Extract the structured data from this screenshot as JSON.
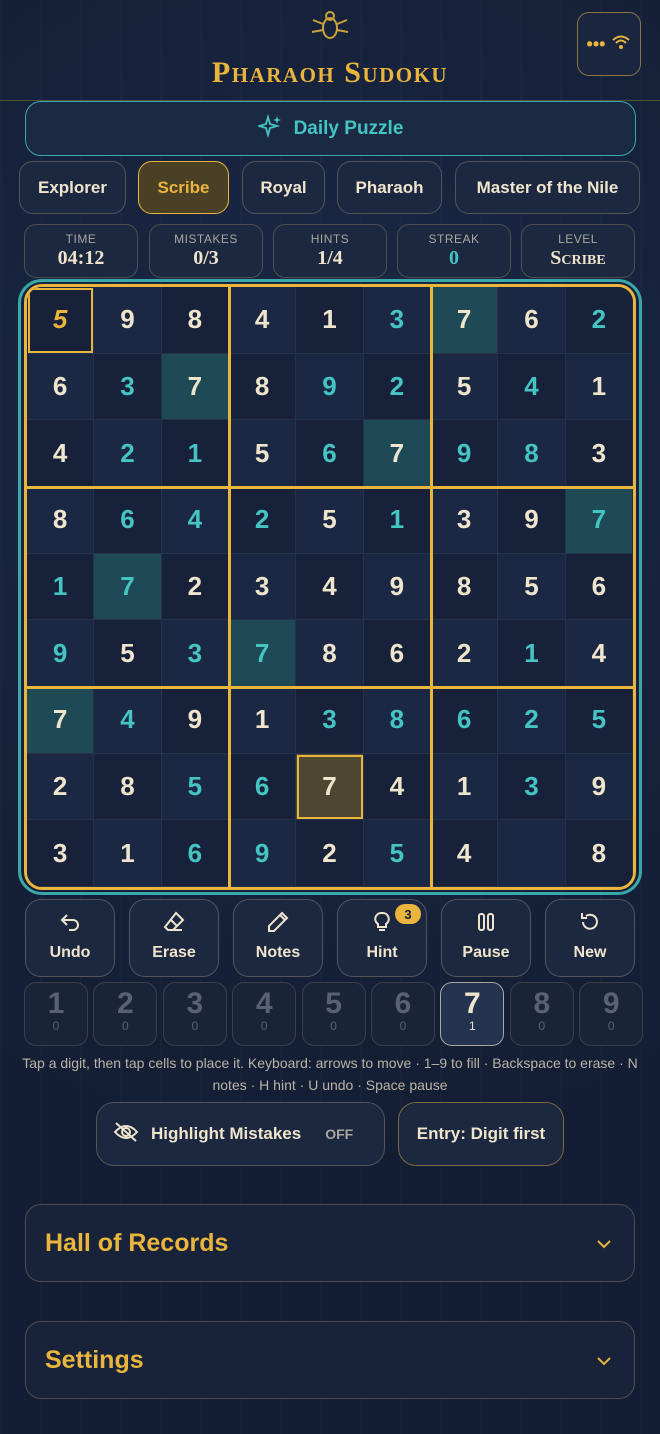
{
  "header": {
    "title": "Pharaoh Sudoku",
    "menu_dots": "•••",
    "menu_icon": "wifi-icon"
  },
  "daily": {
    "label": "Daily Puzzle",
    "icon": "sparkle-icon"
  },
  "levels": [
    "Explorer",
    "Scribe",
    "Royal",
    "Pharaoh",
    "Master of the Nile"
  ],
  "active_level": "Scribe",
  "stats": [
    {
      "label": "TIME",
      "value": "04:12"
    },
    {
      "label": "MISTAKES",
      "value": "0/3"
    },
    {
      "label": "HINTS",
      "value": "1/4"
    },
    {
      "label": "STREAK",
      "value": "0"
    },
    {
      "label": "LEVEL",
      "value": "Scribe"
    }
  ],
  "board": {
    "values": [
      [
        "5",
        "9",
        "8",
        "4",
        "1",
        "3",
        "7",
        "6",
        "2"
      ],
      [
        "6",
        "3",
        "7",
        "8",
        "9",
        "2",
        "5",
        "4",
        "1"
      ],
      [
        "4",
        "2",
        "1",
        "5",
        "6",
        "7",
        "9",
        "8",
        "3"
      ],
      [
        "8",
        "6",
        "4",
        "2",
        "5",
        "1",
        "3",
        "9",
        "7"
      ],
      [
        "1",
        "7",
        "2",
        "3",
        "4",
        "9",
        "8",
        "5",
        "6"
      ],
      [
        "9",
        "5",
        "3",
        "7",
        "8",
        "6",
        "2",
        "1",
        "4"
      ],
      [
        "7",
        "4",
        "9",
        "1",
        "3",
        "8",
        "6",
        "2",
        "5"
      ],
      [
        "2",
        "8",
        "5",
        "6",
        "7",
        "4",
        "1",
        "3",
        "9"
      ],
      [
        "3",
        "1",
        "6",
        "9",
        "2",
        "5",
        "4",
        "",
        "8"
      ]
    ],
    "user_entered": [
      [
        0,
        0,
        0,
        0,
        0,
        1,
        0,
        0,
        1
      ],
      [
        0,
        1,
        0,
        0,
        1,
        1,
        0,
        1,
        0
      ],
      [
        0,
        1,
        1,
        0,
        1,
        0,
        1,
        1,
        0
      ],
      [
        0,
        1,
        1,
        1,
        0,
        1,
        0,
        0,
        1
      ],
      [
        1,
        1,
        0,
        0,
        0,
        0,
        0,
        0,
        0
      ],
      [
        1,
        0,
        1,
        1,
        0,
        0,
        0,
        1,
        0
      ],
      [
        0,
        1,
        0,
        0,
        1,
        1,
        1,
        1,
        1
      ],
      [
        0,
        0,
        1,
        1,
        0,
        0,
        0,
        1,
        0
      ],
      [
        0,
        0,
        1,
        1,
        0,
        1,
        0,
        0,
        0
      ]
    ],
    "highlighted_digit": "7",
    "selected_cell": "r1c1",
    "focused_cell": "r8c5"
  },
  "actions": [
    {
      "label": "Undo",
      "icon": "undo-icon"
    },
    {
      "label": "Erase",
      "icon": "eraser-icon"
    },
    {
      "label": "Notes",
      "icon": "pencil-icon"
    },
    {
      "label": "Hint",
      "icon": "lightbulb-icon",
      "badge": "3"
    },
    {
      "label": "Pause",
      "icon": "pause-icon"
    },
    {
      "label": "New",
      "icon": "refresh-icon"
    }
  ],
  "digits": [
    {
      "d": "1",
      "count": "0"
    },
    {
      "d": "2",
      "count": "0"
    },
    {
      "d": "3",
      "count": "0"
    },
    {
      "d": "4",
      "count": "0"
    },
    {
      "d": "5",
      "count": "0"
    },
    {
      "d": "6",
      "count": "0"
    },
    {
      "d": "7",
      "count": "1"
    },
    {
      "d": "8",
      "count": "0"
    },
    {
      "d": "9",
      "count": "0"
    }
  ],
  "active_digit": "7",
  "help_text": "Tap a digit, then tap cells to place it. Keyboard: arrows to move · 1–9 to fill · Backspace to erase · N notes · H hint · U undo · Space pause",
  "toggles": {
    "highlight_label": "Highlight Mistakes",
    "highlight_state": "OFF",
    "entry_label": "Entry: Digit first"
  },
  "panels": {
    "records": "Hall of Records",
    "settings": "Settings"
  },
  "colors": {
    "gold": "#e9b53c",
    "teal": "#45c4c4",
    "bg": "#15213a",
    "cream": "#efe4cc"
  }
}
